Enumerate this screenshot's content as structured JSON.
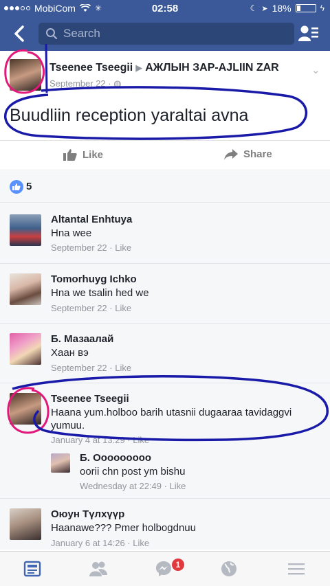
{
  "status_bar": {
    "carrier": "MobiCom",
    "time": "02:58",
    "battery": "18%",
    "battery_level": 0.18
  },
  "navbar": {
    "search_placeholder": "Search",
    "back_icon": "chevron-left-icon",
    "people_icon": "friend-requests-icon"
  },
  "post": {
    "author": "Tseenee Tseegii",
    "target": "АЖЛЫН ЗАР-AJLIIN ZAR",
    "date": "September 22",
    "text": "Buudliin reception yaraltai avna",
    "like_label": "Like",
    "share_label": "Share",
    "like_count": "5"
  },
  "comments": [
    {
      "name": "Altantal Enhtuya",
      "text": "Hna wee",
      "meta": "September 22 · Like"
    },
    {
      "name": "Tomorhuyg Ichko",
      "text": "Hna we tsalin hed we",
      "meta": "September 22 · Like"
    },
    {
      "name": "Б. Мазаалай",
      "text": "Хаан вэ",
      "meta": "September 22 · Like"
    },
    {
      "name": "Tseenee Tseegii",
      "text": "Haana yum.holboo barih utasnii dugaaraa tavidaggvi yumuu.",
      "meta": "January 4 at 13:29 · Like"
    },
    {
      "name": "Б. Ооооооооо",
      "text": "oorii chn post ym bishu",
      "meta": "Wednesday at 22:49 · Like",
      "reply": true
    },
    {
      "name": "Оюун Түлхүүр",
      "text": "Haanawe??? Pmer holbogdnuu",
      "meta": "January 6 at 14:26 · Like"
    }
  ],
  "tabbar": {
    "tabs": [
      "news-feed-icon",
      "friends-icon",
      "messenger-icon",
      "globe-icon",
      "menu-icon"
    ],
    "messenger_badge": "1"
  },
  "colors": {
    "brand": "#3b5998",
    "annotation_blue": "#1a1aa8",
    "annotation_pink": "#e0197a"
  }
}
